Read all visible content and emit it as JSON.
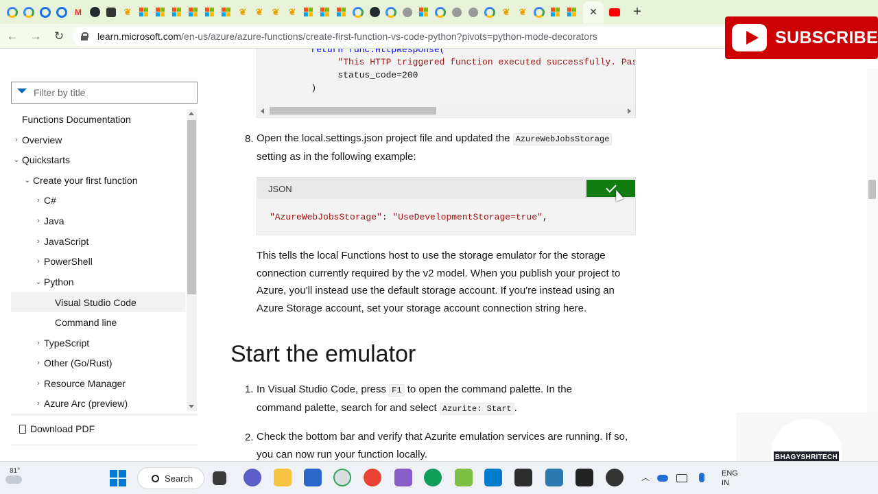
{
  "browser": {
    "url_domain": "learn.microsoft.com",
    "url_path": "/en-us/azure/azure-functions/create-first-function-vs-code-python?pivots=python-mode-decorators",
    "active_tab_close": "✕",
    "new_tab": "+"
  },
  "overlay": {
    "subscribe_label": "SUBSCRIBE",
    "channel_badge": "BHAGYSHRITECH"
  },
  "sidebar": {
    "filter_placeholder": "Filter by title",
    "items": [
      {
        "label": "Functions Documentation",
        "chevron": ""
      },
      {
        "label": "Overview",
        "chevron": "›"
      },
      {
        "label": "Quickstarts",
        "chevron": "⌄"
      },
      {
        "label": "Create your first function",
        "chevron": "⌄"
      },
      {
        "label": "C#",
        "chevron": "›"
      },
      {
        "label": "Java",
        "chevron": "›"
      },
      {
        "label": "JavaScript",
        "chevron": "›"
      },
      {
        "label": "PowerShell",
        "chevron": "›"
      },
      {
        "label": "Python",
        "chevron": "⌄"
      },
      {
        "label": "Visual Studio Code",
        "chevron": ""
      },
      {
        "label": "Command line",
        "chevron": ""
      },
      {
        "label": "TypeScript",
        "chevron": "›"
      },
      {
        "label": "Other (Go/Rust)",
        "chevron": "›"
      },
      {
        "label": "Resource Manager",
        "chevron": "›"
      },
      {
        "label": "Azure Arc (preview)",
        "chevron": "›"
      }
    ],
    "download_pdf": "Download PDF"
  },
  "main": {
    "code1": {
      "lines": [
        "        return func.HttpResponse(",
        "             \"This HTTP triggered function executed successfully. Pass",
        "             status_code=200",
        "        )"
      ]
    },
    "step8": {
      "number": "8.",
      "text_before": "Open the local.settings.json project file and updated the ",
      "code": "AzureWebJobsStorage",
      "text_after": "setting as in the following example:"
    },
    "code2": {
      "language": "JSON",
      "key": "\"AzureWebJobsStorage\"",
      "colon": ": ",
      "value": "\"UseDevelopmentStorage=true\"",
      "trail": ","
    },
    "para": "This tells the local Functions host to use the storage emulator for the storage connection currently required by the v2 model. When you publish your project to Azure, you'll instead use the default storage account. If you're instead using an Azure Storage account, set your storage account connection string here.",
    "heading": "Start the emulator",
    "step1": {
      "number": "1.",
      "t1": "In Visual Studio Code, press ",
      "key": "F1",
      "t2": " to open the command palette. In the",
      "t3": "command palette, search for and select ",
      "code": "Azurite: Start",
      "t4": "."
    },
    "step2": {
      "number": "2.",
      "text": "Check the bottom bar and verify that Azurite emulation services are running. If so, you can now run your function locally."
    }
  },
  "taskbar": {
    "weather": "81°",
    "search_label": "Search",
    "lang_line1": "ENG",
    "lang_line2": "IN"
  },
  "colors": {
    "tabstrip_bg": "#e7f2d9",
    "copy_button": "#107c10",
    "subscribe_red": "#cc0000",
    "link_blue": "#0067b8"
  }
}
